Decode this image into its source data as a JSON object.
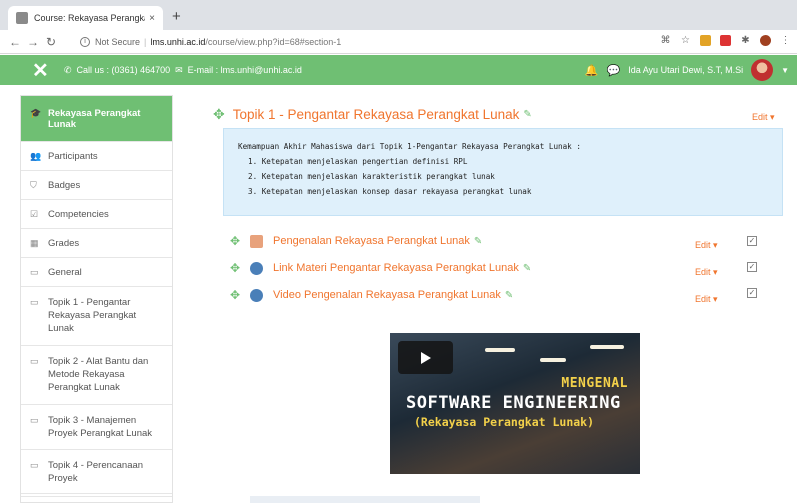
{
  "browser": {
    "tab_title": "Course: Rekayasa Perangkat L",
    "tab_close": "×",
    "new_tab": "+",
    "security": "Not Secure",
    "url_host": "lms.unhi.ac.id",
    "url_path": "/course/view.php?id=68#section-1"
  },
  "navbar": {
    "close_glyph": "✕",
    "call": "Call us : (0361) 464700",
    "email": "E-mail : lms.unhi@unhi.ac.id",
    "user_name": "Ida Ayu Utari Dewi, S.T, M.Si"
  },
  "drawer": {
    "items": [
      {
        "label": "Rekayasa Perangkat Lunak"
      },
      {
        "label": "Participants"
      },
      {
        "label": "Badges"
      },
      {
        "label": "Competencies"
      },
      {
        "label": "Grades"
      },
      {
        "label": "General"
      },
      {
        "label": "Topik 1 - Pengantar Rekayasa Perangkat Lunak"
      },
      {
        "label": "Topik 2 - Alat Bantu dan Metode Rekayasa Perangkat Lunak"
      },
      {
        "label": "Topik 3 - Manajemen Proyek Perangkat Lunak"
      },
      {
        "label": "Topik 4 - Perencanaan Proyek"
      }
    ]
  },
  "section": {
    "title": "Topik 1 - Pengantar Rekayasa Perangkat Lunak",
    "edit_label": "Edit",
    "summary_intro": "Kemampuan Akhir Mahasiswa dari Topik 1-Pengantar Rekayasa Perangkat Lunak  :",
    "summary_items": [
      "1. Ketepatan menjelaskan pengertian definisi RPL",
      "2. Ketepatan menjelaskan karakteristik perangkat lunak",
      "3. Ketepatan menjelaskan konsep dasar rekayasa perangkat lunak"
    ],
    "activities": [
      {
        "name": "Pengenalan Rekayasa Perangkat Lunak",
        "edit": "Edit"
      },
      {
        "name": "Link Materi Pengantar Rekayasa Perangkat Lunak",
        "edit": "Edit"
      },
      {
        "name": "Video Pengenalan Rekayasa Perangkat Lunak",
        "edit": "Edit"
      }
    ]
  },
  "video": {
    "line1": "MENGENAL",
    "line2": "SOFTWARE ENGINEERING",
    "line3": "(Rekayasa Perangkat Lunak)"
  },
  "colors": {
    "brand_green": "#6fbf73",
    "accent_orange": "#f0752e",
    "summary_bg": "#dff0fb"
  }
}
